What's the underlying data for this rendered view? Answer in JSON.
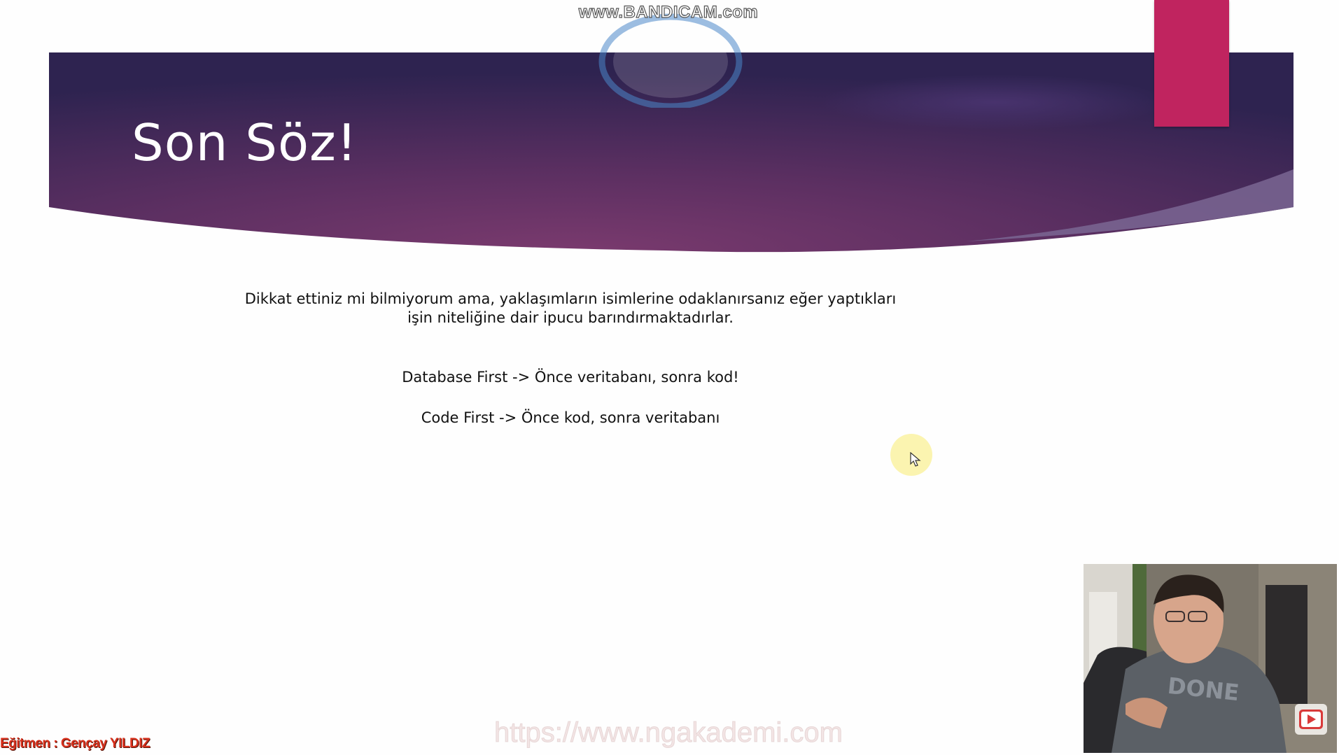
{
  "overlay": {
    "recorder_watermark": "www.BANDICAM.com",
    "site_watermark": "https://www.ngakademi.com",
    "instructor_credit": "Eğitmen : Gençay YILDIZ"
  },
  "slide": {
    "title": "Son Söz!",
    "intro_line1": "Dikkat ettiniz mi bilmiyorum ama, yaklaşımların isimlerine odaklanırsanız eğer yaptıkları",
    "intro_line2": "işin niteliğine dair ipucu barındırmaktadırlar.",
    "database_first": "Database First -> Önce veritabanı, sonra kod!",
    "code_first": "Code First -> Önce kod, sonra veritabanı"
  },
  "webcam": {
    "shirt_text": "DONE"
  },
  "colors": {
    "banner_dark": "#2f2350",
    "banner_mid": "#6b3566",
    "accent": "#c0245f",
    "instructor_text": "#d8301c"
  },
  "icons": [
    "cursor-pointer-icon",
    "youtube-play-icon"
  ]
}
